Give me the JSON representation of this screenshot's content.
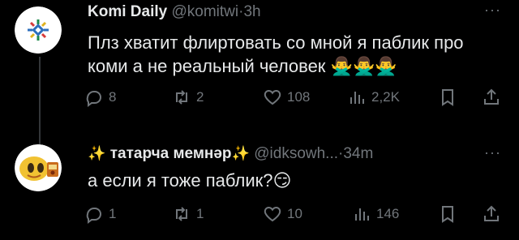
{
  "tweets": [
    {
      "name": "Komi Daily",
      "handle": "@komitwi",
      "dot": "·",
      "time": "3h",
      "text": "Плз хватит флиртовать со мной я паблик про коми а не реальный человек",
      "emoji": "🙅‍♂️🙅‍♂️🙅‍♂️",
      "more": "···",
      "replies": "8",
      "retweets": "2",
      "likes": "108",
      "views": "2,2K",
      "avatar_icon": "komi-sun-logo-icon"
    },
    {
      "name_sparkle_left": "✨",
      "name": "татарча мемнәр",
      "name_sparkle_right": "✨",
      "handle": "@idksowh...",
      "dot": "·",
      "time": "34m",
      "text": "а если я тоже паблик?",
      "emoji": "😏",
      "more": "···",
      "replies": "1",
      "retweets": "1",
      "likes": "10",
      "views": "146",
      "avatar_icon": "yellow-meme-character-avatar"
    }
  ],
  "colors": {
    "background": "#000000",
    "text": "#e7e9ea",
    "muted": "#71767b",
    "thread_line": "#333639"
  }
}
